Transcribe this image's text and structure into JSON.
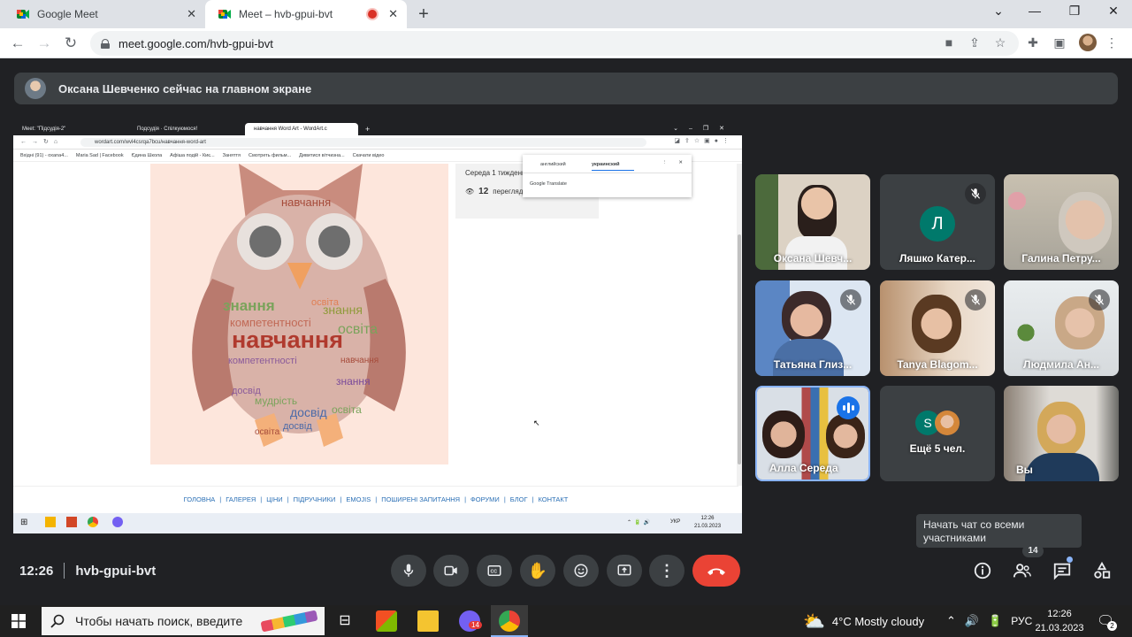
{
  "browser": {
    "tabs": [
      {
        "label": "Google Meet",
        "active": false
      },
      {
        "label": "Meet – hvb-gpui-bvt",
        "active": true
      }
    ],
    "url": "meet.google.com/hvb-gpui-bvt"
  },
  "meet": {
    "notice": "Оксана Шевченко сейчас на главном экране",
    "time": "12:26",
    "code": "hvb-gpui-bvt",
    "tooltip": "Начать чат со всеми участниками",
    "people_badge": "14"
  },
  "shared_screen": {
    "tabs": [
      "Meet: \"Підсудія-2\"",
      "Подсудія · Спілкуюмося!",
      "навчання Word Art - WordArt.c"
    ],
    "url": "wordart.com/wvl4csrqa7bcu/навчання-word-art",
    "bookmarks": [
      "Вхідні (91) - oxana4...",
      "Maria Sad | Facebook",
      "Єдина Школа",
      "Афіша подій - Киє...",
      "Заняття",
      "Смотреть фильм...",
      "Дивитися вітчизна...",
      "Скачати відео"
    ],
    "translate": {
      "lang_from": "английский",
      "lang_to": "украинский",
      "brand": "Google Translate"
    },
    "info_date": "Середа 1 тиждень",
    "views_count": "12",
    "views_label": "переглядів",
    "footer_links": [
      "ГОЛОВНА",
      "ГАЛЕРЕЯ",
      "ЦІНИ",
      "ПІДРУЧНИКИ",
      "EMOJIS",
      "ПОШИРЕНІ ЗАПИТАННЯ",
      "ФОРУМИ",
      "БЛОГ",
      "КОНТАКТ"
    ],
    "taskbar_time": "12:26",
    "taskbar_date": "21.03.2023",
    "taskbar_lang": "УКР",
    "owl_words": {
      "w1": "навчання",
      "w2": "знання",
      "w3": "освіта",
      "w4": "компетентності",
      "w5": "навчання",
      "w6": "освіта",
      "w7": "компетентності",
      "w8": "знання",
      "w9": "навчання",
      "w10": "мудрість",
      "w11": "досвід",
      "w12": "досвід",
      "w13": "освіта",
      "w14": "освіта",
      "w15": "знання",
      "w16": "досвід"
    }
  },
  "participants": [
    {
      "name": "Оксана Шевч...",
      "muted": false
    },
    {
      "name": "Ляшко Катер...",
      "muted": true,
      "initial": "Л"
    },
    {
      "name": "Галина Петру...",
      "muted": false
    },
    {
      "name": "Татьяна Глиз...",
      "muted": true
    },
    {
      "name": "Tanya Blagom...",
      "muted": true
    },
    {
      "name": "Людмила Ан...",
      "muted": true
    },
    {
      "name": "Алла Середа",
      "speaking": true
    },
    {
      "name": "Ещё 5 чел.",
      "initial": "S"
    },
    {
      "name": "Вы"
    }
  ],
  "taskbar": {
    "search_placeholder": "Чтобы начать поиск, введите",
    "weather": "4°C  Mostly cloudy",
    "lang": "РУС",
    "time": "12:26",
    "date": "21.03.2023",
    "notif_count": "2",
    "viber_badge": "14"
  },
  "colors": {
    "meet_bg": "#202124",
    "tile_bg": "#3c4043",
    "end_call": "#ea4335",
    "accent": "#8ab4f8",
    "speaking": "#1a73e8"
  }
}
